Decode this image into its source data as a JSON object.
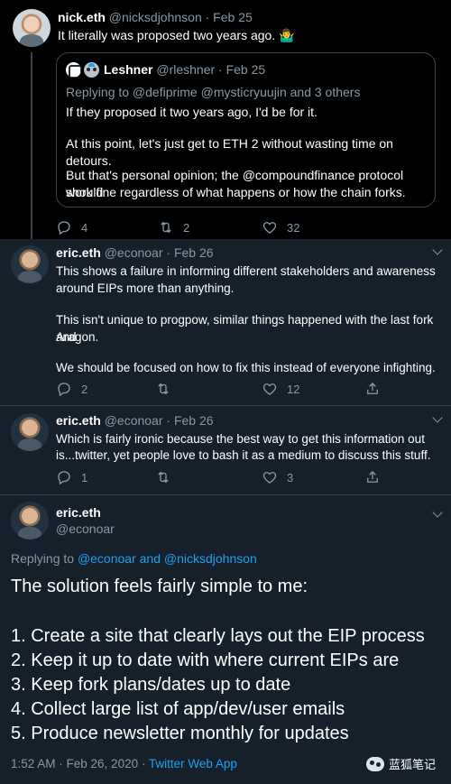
{
  "tweet1": {
    "display_name": "nick.eth",
    "handle": "@nicksdjohnson",
    "date": "· Feb 25",
    "text": "It literally was proposed two years ago. 🤷‍♂️",
    "quoted": {
      "display_name": "Leshner",
      "handle": "@rleshner",
      "date": "· Feb 25",
      "replying_to": "Replying to @defiprime @mysticryuujin and 3 others",
      "paragraphs": [
        "If they proposed it two years ago, I'd be for it.",
        "At this point, let's just get to ETH 2 without wasting time on detours.",
        "But that's personal opinion; the @compoundfinance protocol should",
        "work fine regardless of what happens or how the chain forks."
      ]
    },
    "reply_count": "4",
    "retweet_count": "2",
    "like_count": "32"
  },
  "tweet2": {
    "display_name": "eric.eth",
    "handle": "@econoar",
    "date": "· Feb 26",
    "lines": [
      "This shows a failure in informing different stakeholders and awareness",
      "around EIPs more than anything.",
      "This isn't unique to progpow, similar things happened with the last fork and",
      "Aragon.",
      "We should be focused on how to fix this instead of everyone infighting."
    ],
    "reply_count": "2",
    "retweet_count": "",
    "like_count": "12"
  },
  "tweet3": {
    "display_name": "eric.eth",
    "handle": "@econoar",
    "date": "· Feb 26",
    "lines": [
      "Which is fairly ironic because the best way to get this information out",
      "is...twitter, yet people love to bash it as a medium to discuss this stuff."
    ],
    "reply_count": "1",
    "retweet_count": "",
    "like_count": "3"
  },
  "main_tweet": {
    "display_name": "eric.eth",
    "handle": "@econoar",
    "replying_prefix": "Replying to",
    "replying_links": "@econoar and @nicksdjohnson",
    "lines": [
      "The solution feels fairly simple to me:",
      "1. Create a site that clearly lays out the EIP process",
      "2. Keep it up to date with where current EIPs are",
      "3. Keep fork plans/dates up to date",
      "4. Collect large list of app/dev/user emails",
      "5. Produce newsletter monthly for updates"
    ],
    "timestamp": "1:52 AM · Feb 26, 2020 · ",
    "source": "Twitter Web App"
  },
  "watermark": "蓝狐笔记",
  "colors": {
    "background": "#15202b",
    "border": "#38444d",
    "muted": "#8899a6",
    "accent": "#1da1f2"
  }
}
